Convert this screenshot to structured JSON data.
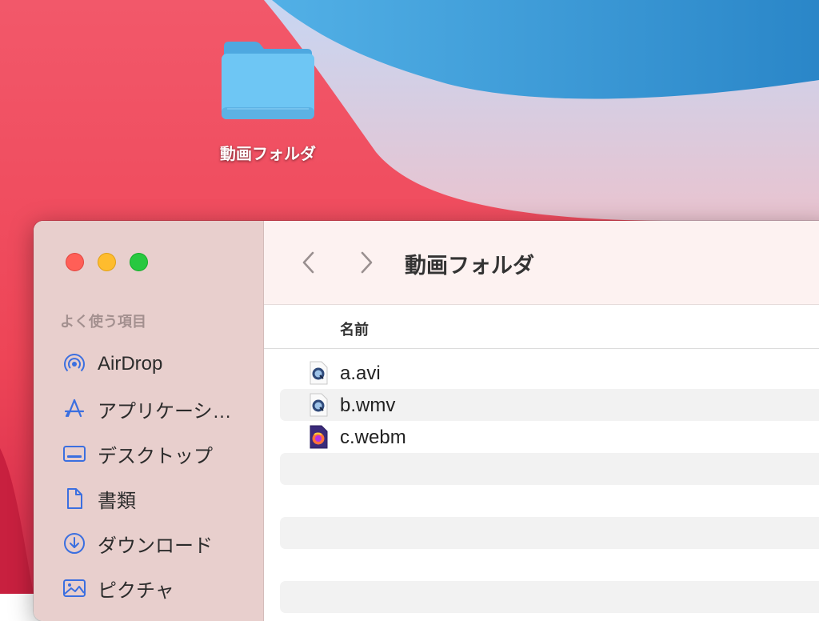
{
  "desktop": {
    "folder_label": "動画フォルダ",
    "folder_icon": "folder-icon",
    "colors": {
      "wallpaper_red": "#f0485a",
      "wallpaper_blue": "#3b93d6",
      "folder_blue": "#6ec6f4"
    }
  },
  "window": {
    "title": "動画フォルダ",
    "nav": {
      "back_icon": "chevron-left-icon",
      "forward_icon": "chevron-right-icon"
    },
    "controls": [
      "close",
      "minimize",
      "zoom"
    ]
  },
  "sidebar": {
    "heading": "よく使う項目",
    "items": [
      {
        "label": "AirDrop",
        "icon": "airdrop-icon"
      },
      {
        "label": "アプリケーシ…",
        "icon": "applications-icon"
      },
      {
        "label": "デスクトップ",
        "icon": "desktop-icon"
      },
      {
        "label": "書類",
        "icon": "document-icon"
      },
      {
        "label": "ダウンロード",
        "icon": "download-icon"
      },
      {
        "label": "ピクチャ",
        "icon": "pictures-icon"
      }
    ],
    "accent_color": "#3b6fe0"
  },
  "list": {
    "column_header": "名前",
    "files": [
      {
        "name": "a.avi",
        "icon": "quicktime-file-icon"
      },
      {
        "name": "b.wmv",
        "icon": "quicktime-file-icon"
      },
      {
        "name": "c.webm",
        "icon": "firefox-file-icon"
      }
    ]
  }
}
